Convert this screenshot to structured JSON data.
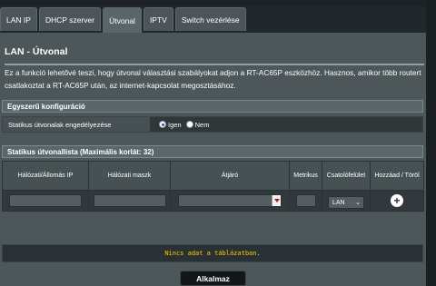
{
  "tabs": [
    {
      "label": "LAN IP",
      "active": false
    },
    {
      "label": "DHCP szerver",
      "active": false
    },
    {
      "label": "Útvonal",
      "active": true
    },
    {
      "label": "IPTV",
      "active": false
    },
    {
      "label": "Switch vezérlése",
      "active": false
    }
  ],
  "page": {
    "title": "LAN - Útvonal",
    "description": "Ez a funkció lehetővé teszi, hogy útvonal választási szabályokat adjon a RT-AC65P eszközhöz. Hasznos, amikor több routert csatlakoztat a RT-AC65P után, az internet-kapcsolat megosztásához."
  },
  "basic": {
    "header": "Egyszerű konfiguráció",
    "static_label": "Statikus útvonalak engedélyezése",
    "option_yes": "Igen",
    "option_no": "Nem",
    "selected": "Igen"
  },
  "route_list": {
    "header": "Statikus útvonallista (Maximális korlát: 32)",
    "columns": [
      "Hálózati/Állomás IP",
      "Hálózati maszk",
      "Átjáró",
      "Metrikus",
      "Csatolófelület",
      "Hozzáad / Töröl"
    ],
    "interface_value": "LAN",
    "empty_message": "Nincs adat a táblázatban."
  },
  "apply_button": "Alkalmaz",
  "colors": {
    "panel_bg": "#4d5659",
    "tab_bg": "#4c5559",
    "empty_text": "#ffcc00",
    "radio_selected": "#1c58d6"
  },
  "icons": {
    "add": "plus-circle-icon",
    "dropdown": "chevron-down-icon"
  }
}
